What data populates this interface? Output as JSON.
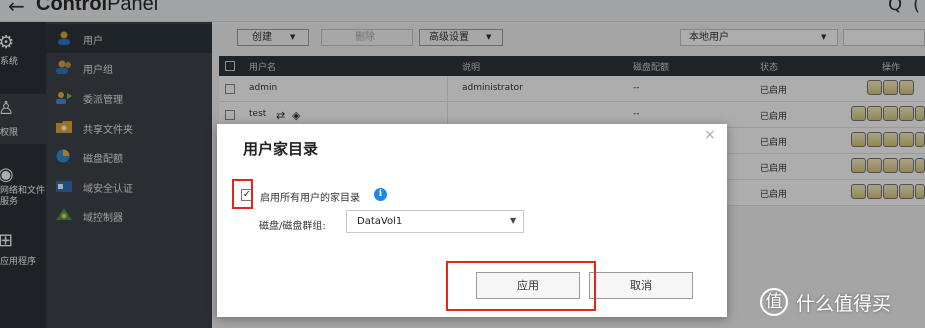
{
  "app": {
    "title_prefix": "Control",
    "title_suffix": "Panel",
    "back_icon": "arrow-left-icon"
  },
  "rail": [
    {
      "label": "系统",
      "icon": "gear-icon"
    },
    {
      "label": "权限",
      "icon": "user-icon"
    },
    {
      "label": "网络和文件服务",
      "icon": "globe-icon"
    },
    {
      "label": "应用程序",
      "icon": "grid-icon"
    }
  ],
  "sidebar": {
    "items": [
      {
        "label": "用户",
        "icon": "user-icon",
        "color": "#d9a441"
      },
      {
        "label": "用户组",
        "icon": "users-icon",
        "color": "#d9a441"
      },
      {
        "label": "委派管理",
        "icon": "delegate-icon",
        "color": "#e0b24a"
      },
      {
        "label": "共享文件夹",
        "icon": "folder-icon",
        "color": "#e0a93a"
      },
      {
        "label": "磁盘配额",
        "icon": "pie-icon",
        "color": "#2f8fd8"
      },
      {
        "label": "域安全认证",
        "icon": "id-card-icon",
        "color": "#2f6fb8"
      },
      {
        "label": "域控制器",
        "icon": "domain-icon",
        "color": "#3f9a45"
      }
    ]
  },
  "toolbar": {
    "create_label": "创建",
    "delete_label": "删除",
    "advanced_label": "高级设置",
    "scope_value": "本地用户"
  },
  "table": {
    "headers": {
      "name": "用户名",
      "desc": "说明",
      "quota": "磁盘配额",
      "status": "状态",
      "ops": "操作"
    },
    "rows": [
      {
        "name": "admin",
        "desc": "administrator",
        "quota": "--",
        "status": "已启用"
      },
      {
        "name": "test",
        "desc": "",
        "quota": "--",
        "status": "已启用"
      },
      {
        "name": "",
        "desc": "",
        "quota": "--",
        "status": "已启用"
      },
      {
        "name": "",
        "desc": "",
        "quota": "--",
        "status": "已启用"
      },
      {
        "name": "",
        "desc": "",
        "quota": "--",
        "status": "已启用"
      }
    ]
  },
  "modal": {
    "title": "用户家目录",
    "checkbox_label": "启用所有用户的家目录",
    "checkbox_checked": true,
    "field_label": "磁盘/磁盘群组:",
    "select_value": "DataVol1",
    "apply_label": "应用",
    "cancel_label": "取消",
    "info_glyph": "i",
    "close_glyph": "×"
  },
  "watermark": {
    "logo_glyph": "值",
    "text": "什么值得买"
  },
  "colors": {
    "highlight": "#e3261c",
    "info": "#1e88e5"
  }
}
